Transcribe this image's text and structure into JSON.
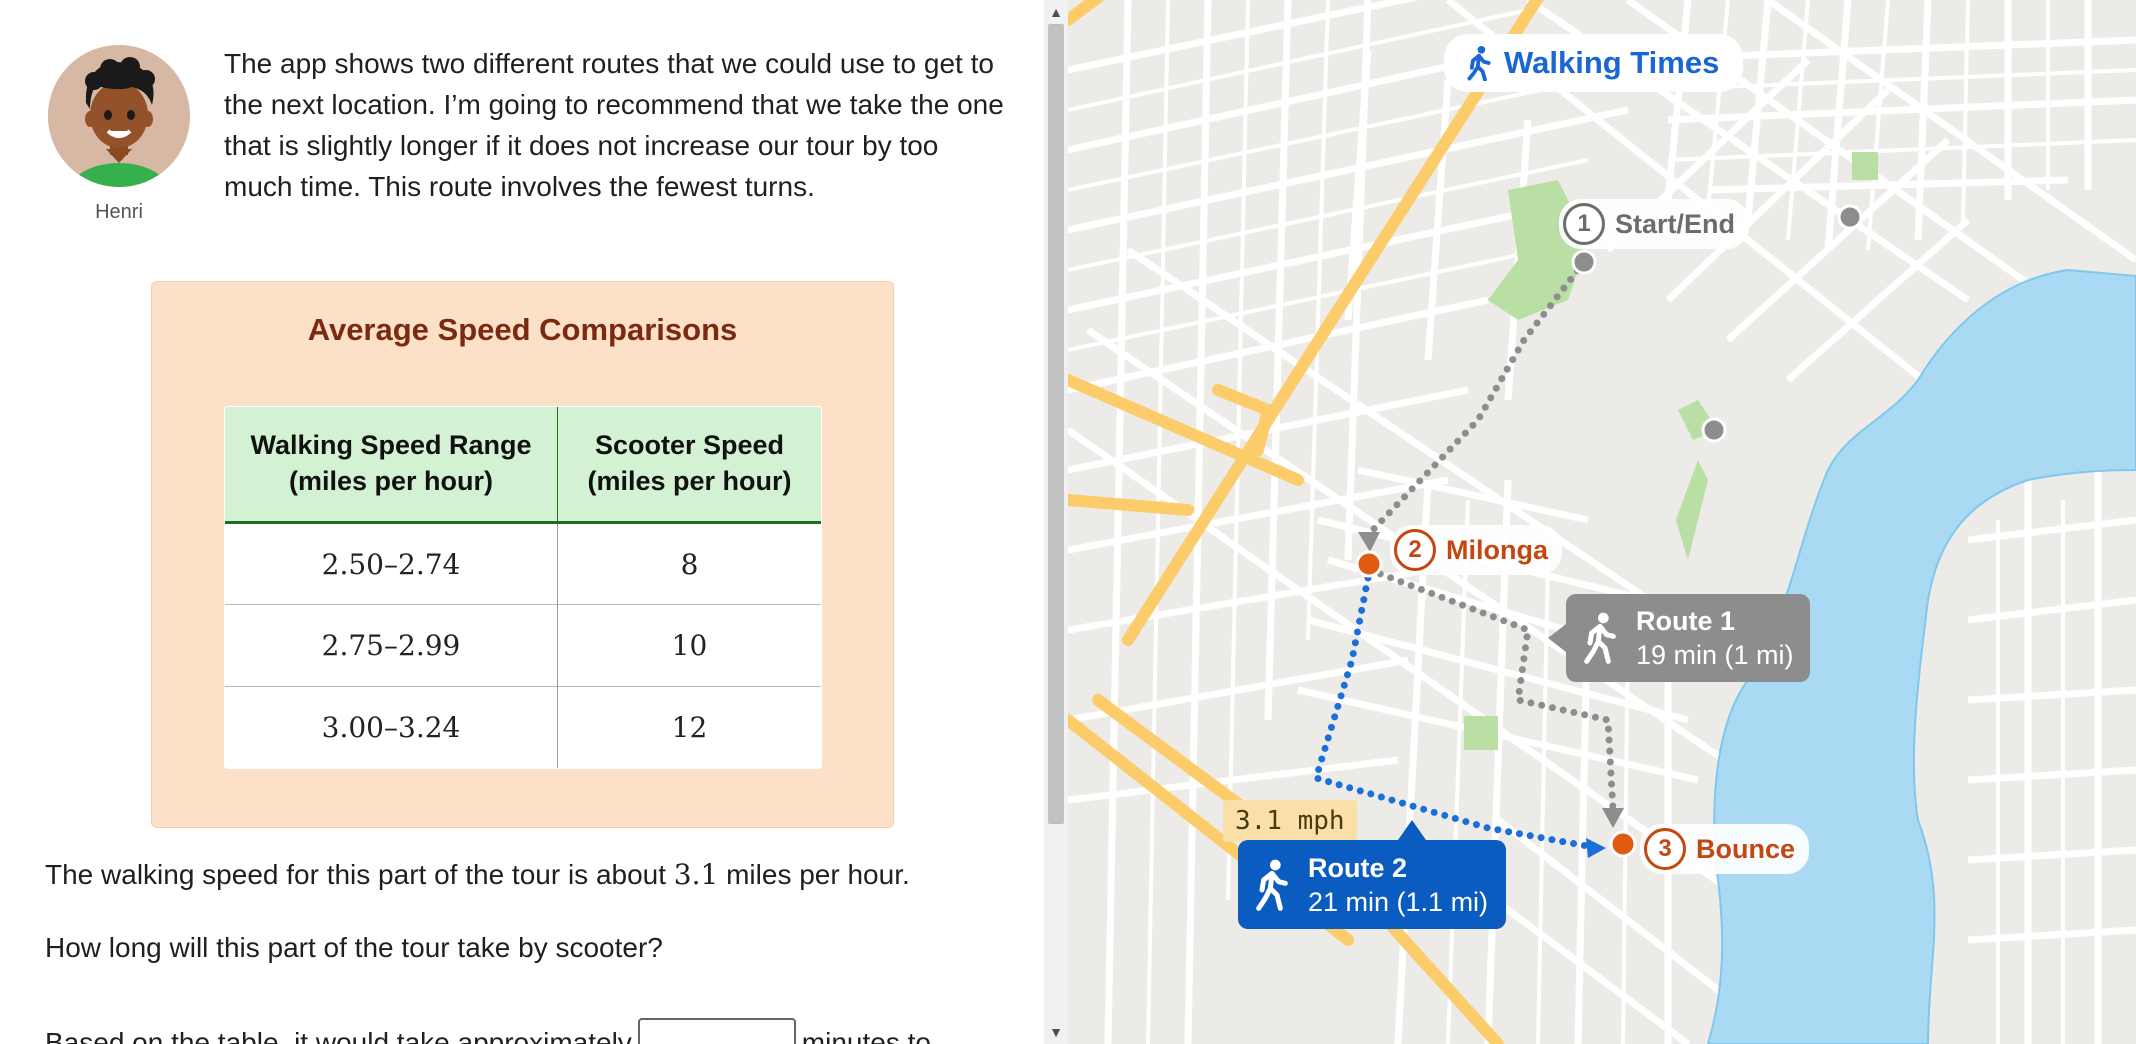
{
  "character": {
    "name": "Henri",
    "message": "The app shows two different routes that we could use to get to the next location. I’m going to recommend that we take the one that is slightly longer if it does not increase our tour by too much time. This route involves the fewest turns."
  },
  "speed_table": {
    "title": "Average Speed Comparisons",
    "headers": [
      {
        "line1": "Walking Speed Range",
        "line2": "(miles per hour)"
      },
      {
        "line1": "Scooter Speed",
        "line2": "(miles per hour)"
      }
    ],
    "rows": [
      {
        "walking": "2.50–2.74",
        "scooter": "8"
      },
      {
        "walking": "2.75–2.99",
        "scooter": "10"
      },
      {
        "walking": "3.00–3.24",
        "scooter": "12"
      }
    ]
  },
  "question": {
    "speed_text_before": "The walking speed for this part of the tour is about ",
    "speed_value": "3.1",
    "speed_text_after": " miles per hour.",
    "prompt": "How long will this part of the tour take by scooter?",
    "answer_text_before": "Based on the table, it would take approximately",
    "answer_value": "",
    "answer_text_after": "minutes to"
  },
  "map": {
    "header": "Walking Times",
    "locations": [
      {
        "number": "1",
        "name": "Start/End"
      },
      {
        "number": "2",
        "name": "Milonga"
      },
      {
        "number": "3",
        "name": "Bounce"
      }
    ],
    "routes": [
      {
        "title": "Route 1",
        "detail": "19 min (1 mi)"
      },
      {
        "title": "Route 2",
        "detail": "21 min (1.1 mi)"
      }
    ],
    "speed_note": "3.1 mph"
  },
  "colors": {
    "accent_blue": "#1967d2",
    "route2_blue": "#0b5cc0",
    "route1_gray": "#8d8d8d",
    "location_orange": "#e05a12",
    "table_header_green": "#d3f2d3",
    "card_peach": "#fce0c8",
    "water": "#aadaf3"
  }
}
